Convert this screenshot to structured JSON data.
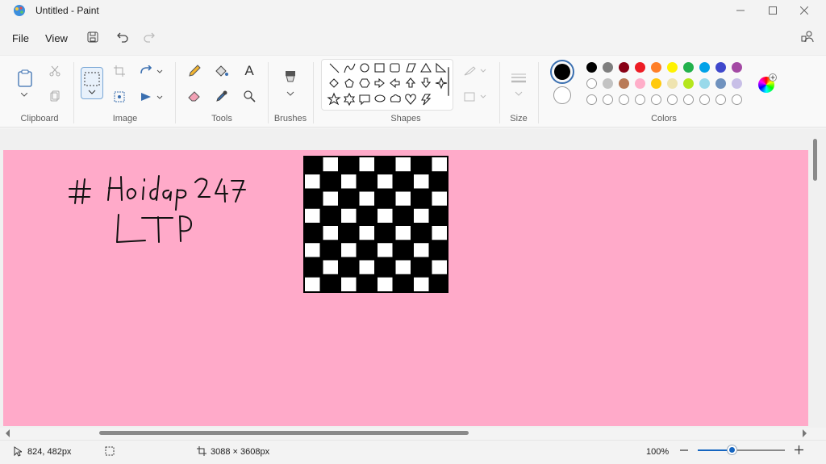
{
  "window": {
    "title": "Untitled - Paint"
  },
  "menu": {
    "file": "File",
    "view": "View"
  },
  "ribbon": {
    "groups": {
      "clipboard": "Clipboard",
      "image": "Image",
      "tools": "Tools",
      "brushes": "Brushes",
      "shapes": "Shapes",
      "size": "Size",
      "colors": "Colors"
    },
    "tools_text_glyph": "A"
  },
  "colors": {
    "primary": "#000000",
    "secondary": "#ffffff",
    "row1": [
      "#000000",
      "#7f7f7f",
      "#880015",
      "#ed1c24",
      "#ff7f27",
      "#fff200",
      "#22b14c",
      "#00a2e8",
      "#3f48cc",
      "#a349a4"
    ],
    "row2": [
      "#ffffff",
      "#c3c3c3",
      "#b97a57",
      "#ffaec9",
      "#ffc90e",
      "#efe4b0",
      "#b5e61d",
      "#99d9ea",
      "#7092be",
      "#c8bfe7"
    ],
    "row3_empty_count": 10
  },
  "canvas": {
    "background": "#ffaac9",
    "handwriting": [
      "# Hoidap247",
      "LTP"
    ]
  },
  "status": {
    "cursor_position": "824, 482px",
    "image_size": "3088 × 3608px",
    "zoom": "100%"
  }
}
